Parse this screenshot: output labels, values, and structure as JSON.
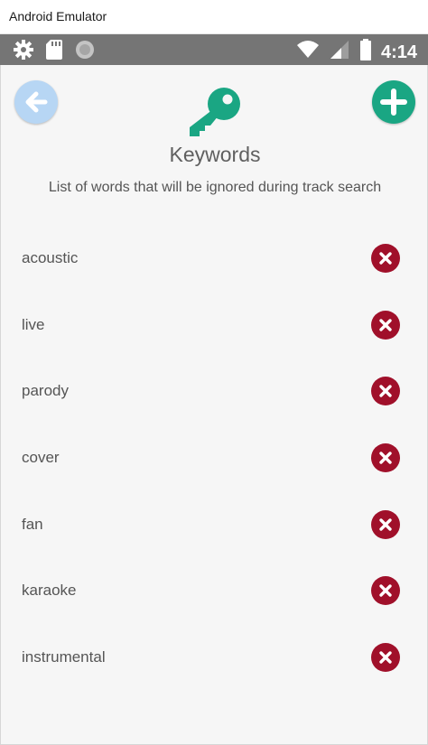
{
  "window": {
    "title": "Android Emulator"
  },
  "statusbar": {
    "icons_left": [
      "gear-icon",
      "sd-card-icon",
      "circle-icon"
    ],
    "icons_right": [
      "wifi-icon",
      "signal-icon",
      "battery-icon"
    ],
    "time": "4:14"
  },
  "header": {
    "title": "Keywords",
    "subtitle": "List of words that will be ignored during track search"
  },
  "colors": {
    "accent": "#1aa683",
    "back": "#b7d6f4",
    "remove": "#a0102a"
  },
  "keywords": [
    "acoustic",
    "live",
    "parody",
    "cover",
    "fan",
    "karaoke",
    "instrumental"
  ]
}
